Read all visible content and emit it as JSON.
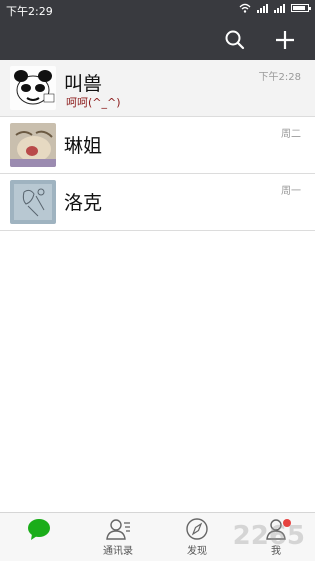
{
  "status_bar": {
    "time": "下午2:29"
  },
  "chats": [
    {
      "name": "叫兽",
      "last_message": "呵呵(^_^)",
      "time": "下午2:28"
    },
    {
      "name": "琳姐",
      "last_message": "",
      "time": "周二"
    },
    {
      "name": "洛克",
      "last_message": "",
      "time": "周一"
    }
  ],
  "tabs": [
    {
      "label": ""
    },
    {
      "label": "通讯录"
    },
    {
      "label": "发现"
    },
    {
      "label": "我"
    }
  ],
  "watermark": {
    "text": "2265"
  },
  "colors": {
    "header": "#393a3f",
    "accent": "#1aad19",
    "badge": "#e64340"
  },
  "icons": [
    "search-icon",
    "plus-icon",
    "chat-bubble-icon",
    "contacts-icon",
    "compass-icon",
    "person-icon"
  ]
}
